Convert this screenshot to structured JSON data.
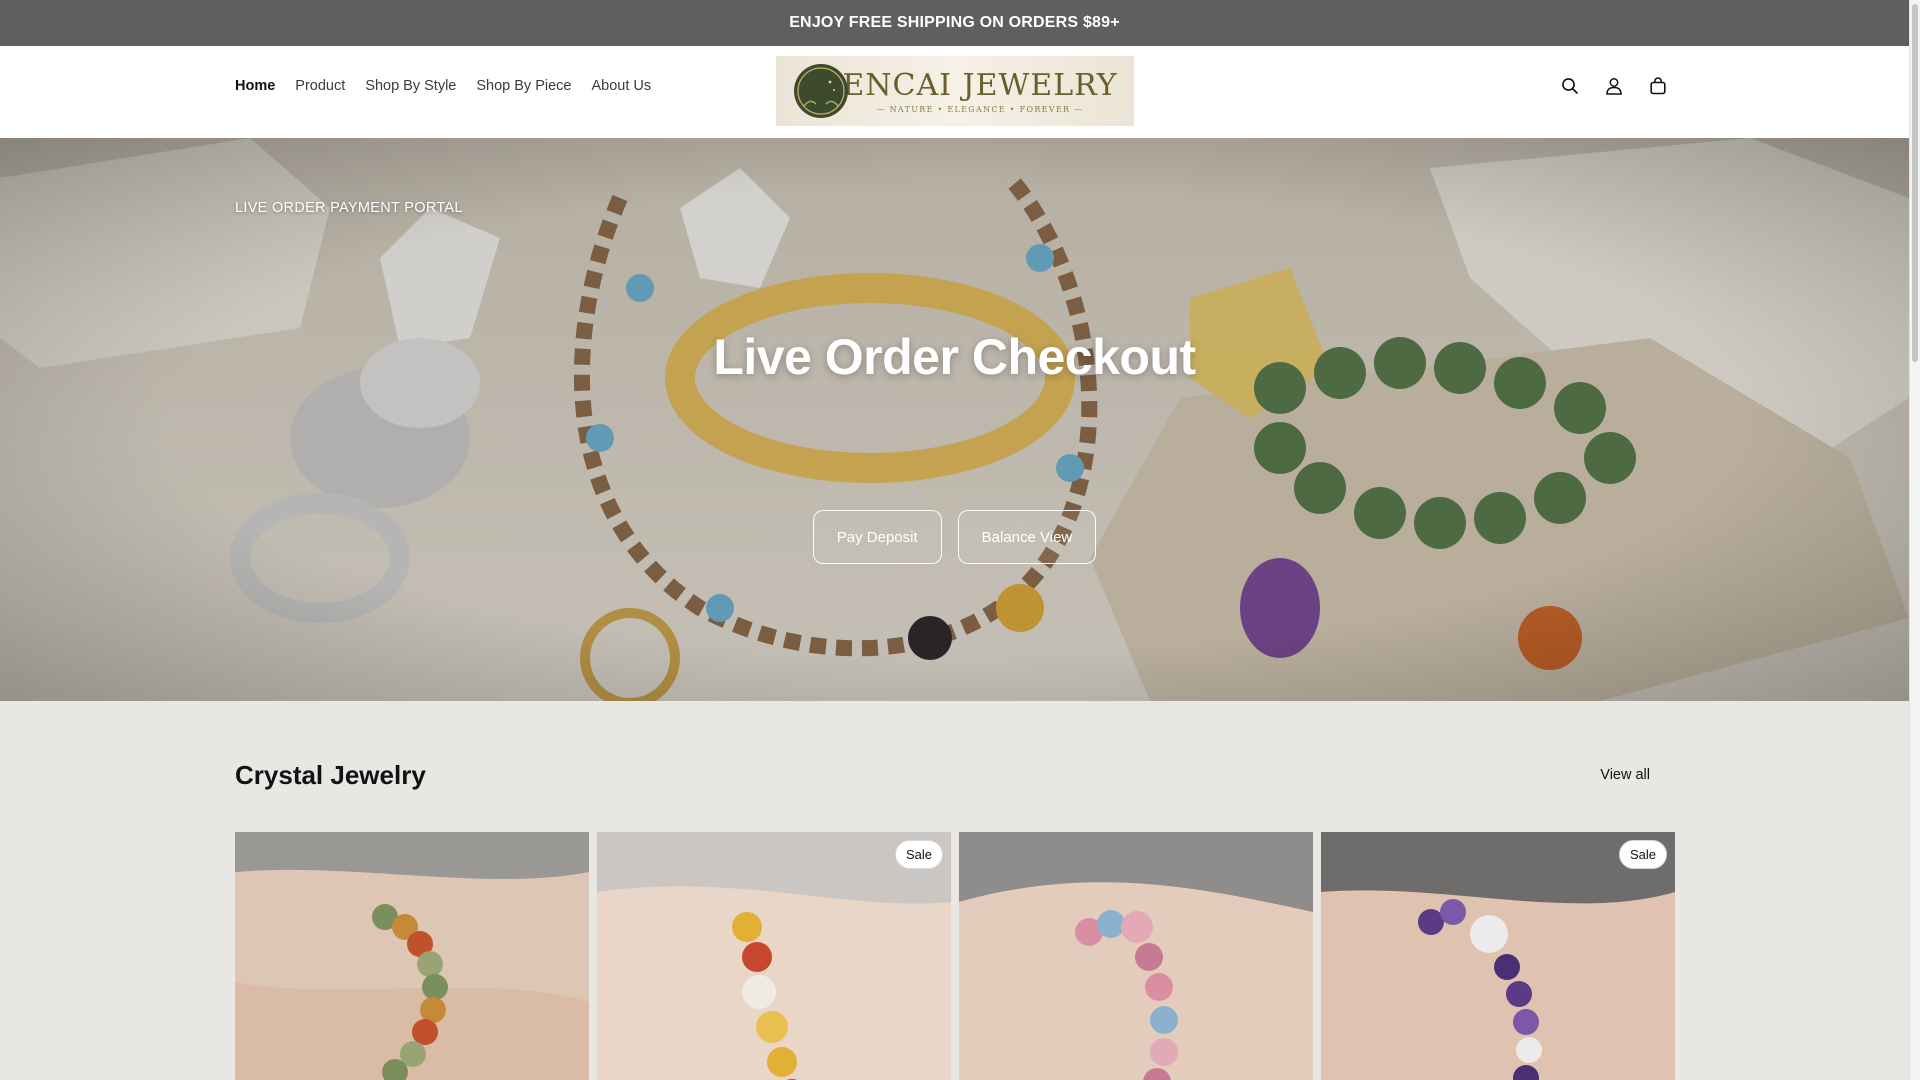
{
  "announcement": {
    "text": "ENJOY FREE SHIPPING ON ORDERS $89+"
  },
  "header": {
    "nav": [
      {
        "label": "Home",
        "active": true
      },
      {
        "label": "Product",
        "active": false
      },
      {
        "label": "Shop By Style",
        "active": false
      },
      {
        "label": "Shop By Piece",
        "active": false
      },
      {
        "label": "About Us",
        "active": false
      }
    ],
    "logo": {
      "title": "ENCAI JEWELRY",
      "tagline": "— NATURE • ELEGANCE • FOREVER —"
    },
    "icons": [
      "search-icon",
      "account-icon",
      "cart-icon"
    ]
  },
  "hero": {
    "eyebrow": "LIVE ORDER PAYMENT PORTAL",
    "title": "Live Order Checkout",
    "buttons": [
      {
        "label": "Pay Deposit"
      },
      {
        "label": "Balance View"
      }
    ]
  },
  "collection": {
    "title": "Crystal Jewelry",
    "view_all": "View all",
    "products": [
      {
        "badge": "",
        "bead_colors": [
          "#7b8f5c",
          "#c48a3a",
          "#c2502a",
          "#9aa374"
        ]
      },
      {
        "badge": "Sale",
        "bead_colors": [
          "#e1b035",
          "#c9462e",
          "#f0ebe2",
          "#e8c052"
        ]
      },
      {
        "badge": "",
        "bead_colors": [
          "#d98ea3",
          "#8bb1cc",
          "#e4a9b6",
          "#c97a93"
        ]
      },
      {
        "badge": "Sale",
        "bead_colors": [
          "#5b3b86",
          "#7c58a8",
          "#eceaea",
          "#4a2f72"
        ]
      }
    ]
  },
  "colors": {
    "announcement_bg": "#5f5f5f",
    "page_bg": "#e9e7e3",
    "text": "#121212"
  }
}
